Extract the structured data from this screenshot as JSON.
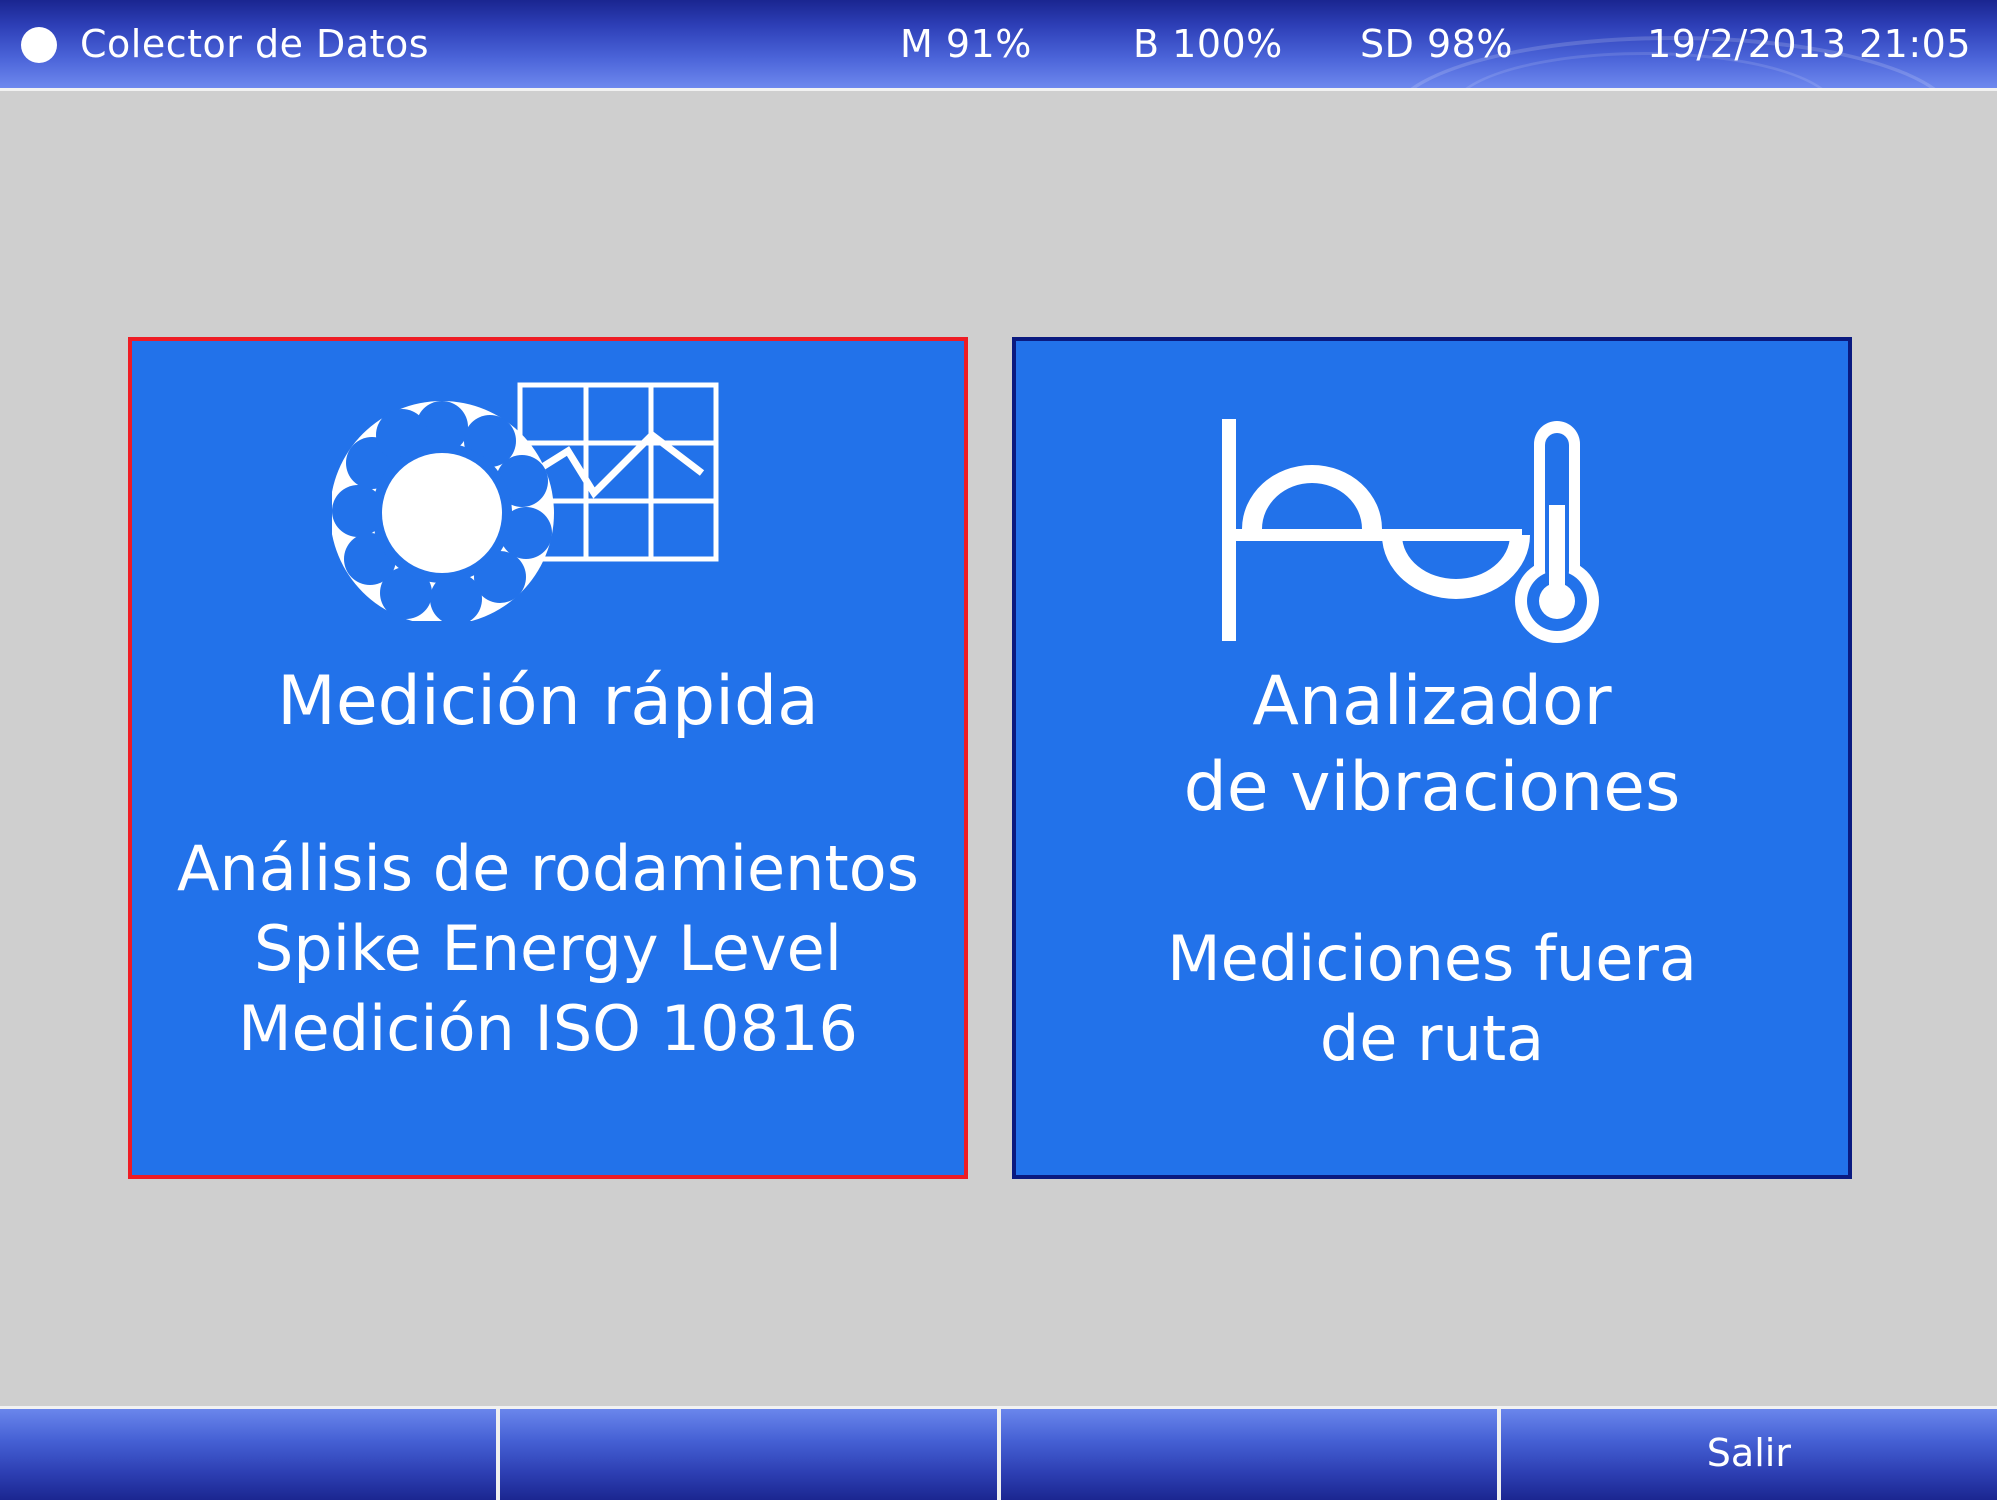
{
  "header": {
    "title": "Colector de Datos",
    "memory": "M 91%",
    "battery": "B 100%",
    "sd": "SD 98%",
    "datetime": "19/2/2013 21:05"
  },
  "tiles": [
    {
      "title": "Medición rápida",
      "lines": [
        "Análisis de rodamientos",
        "Spike Energy Level",
        "Medición ISO 10816"
      ],
      "icon": "bearing-chart-icon",
      "border_color": "#ee1c24"
    },
    {
      "title_lines": [
        "Analizador",
        "de vibraciones"
      ],
      "lines": [
        "Mediciones fuera",
        "de ruta"
      ],
      "icon": "vibration-thermometer-icon",
      "border_color": "#0a1a80"
    }
  ],
  "footer": {
    "keys": [
      "",
      "",
      "",
      "Salir"
    ]
  },
  "colors": {
    "tile_blue": "#2272ea",
    "background": "#cfcfcf",
    "selected_border": "#ee1c24"
  }
}
